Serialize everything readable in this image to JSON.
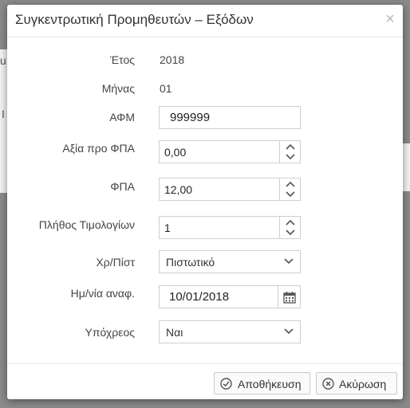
{
  "dialog": {
    "title": "Συγκεντρωτική Προμηθευτών – Εξόδων",
    "close_glyph": "×"
  },
  "form": {
    "year": {
      "label": "Έτος",
      "value": "2018"
    },
    "month": {
      "label": "Μήνας",
      "value": "01"
    },
    "afm": {
      "label": "ΑΦΜ",
      "value": "999999"
    },
    "net_value": {
      "label": "Αξία προ ΦΠΑ",
      "value": "0,00"
    },
    "vat": {
      "label": "ΦΠΑ",
      "value": "12,00"
    },
    "invoice_count": {
      "label": "Πλήθος Τιμολογίων",
      "value": "1"
    },
    "credit_debit": {
      "label": "Χρ/Πίστ",
      "value": "Πιστωτικό"
    },
    "ref_date": {
      "label": "Ημ/νία αναφ.",
      "value": "10/01/2018"
    },
    "obligated": {
      "label": "Υπόχρεος",
      "value": "Ναι"
    }
  },
  "buttons": {
    "save": "Αποθήκευση",
    "cancel": "Ακύρωση"
  },
  "background": {
    "chars": [
      "u",
      "I"
    ]
  },
  "colors": {
    "icon": "#555555",
    "border": "#cfcfcf",
    "overlay": "#8a8a8a"
  },
  "icons": [
    "close-icon",
    "spinner-up-icon",
    "spinner-down-icon",
    "chevron-down-icon",
    "calendar-icon",
    "check-circle-icon",
    "x-circle-icon"
  ]
}
